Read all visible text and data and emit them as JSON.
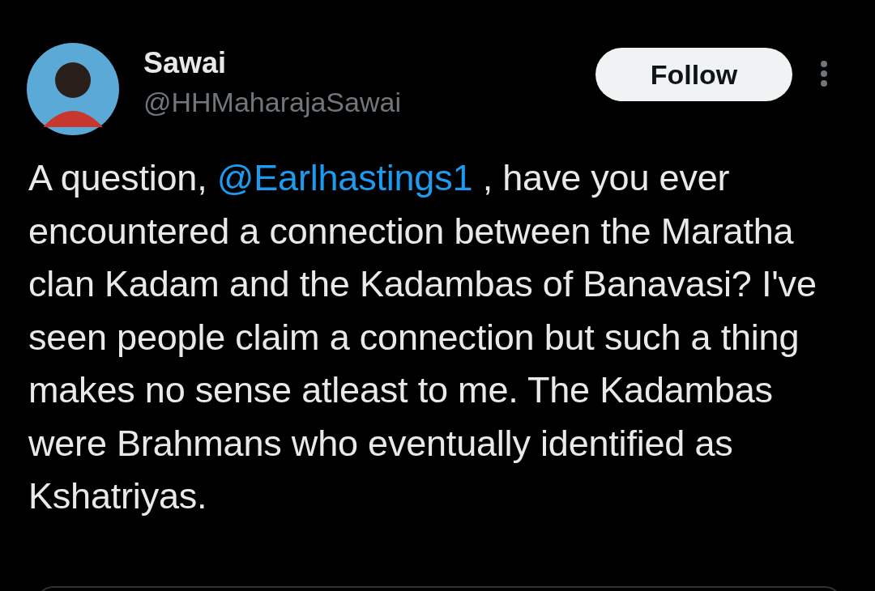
{
  "author": {
    "name": "Sawai",
    "handle": "@HHMaharajaSawai"
  },
  "follow_button": {
    "label": "Follow"
  },
  "tweet": {
    "text_before": "A question, ",
    "mention": "@Earlhastings1",
    "text_after": " , have you ever encountered a connection between the Maratha clan Kadam and the Kadambas of Banavasi? I've seen people claim a connection but such a thing makes no sense atleast to me. The Kadambas were Brahmans who eventually identified as Kshatriyas."
  }
}
